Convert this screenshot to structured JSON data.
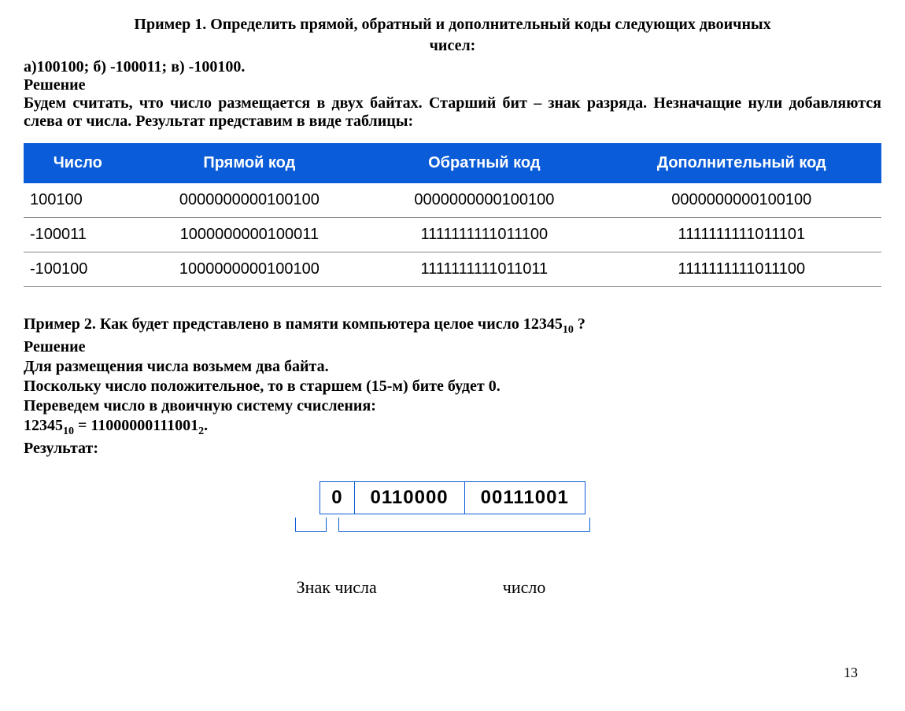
{
  "example1": {
    "title_l1": "Пример 1. Определить прямой, обратный и дополнительный коды следующих двоичных",
    "title_l2": "чисел:",
    "given": "а)100100; б) -100011; в) -100100.",
    "solution_label": "Решение",
    "explain": "Будем считать, что число размещается в двух байтах. Старший бит – знак разряда. Незначащие нули добавляются слева от числа. Результат представим в виде таблицы:",
    "headers": {
      "num": "Число",
      "direct": "Прямой код",
      "inverse": "Обратный код",
      "complement": "Дополнительный код"
    },
    "rows": [
      {
        "num": "100100",
        "direct": "0000000000100100",
        "inverse": "0000000000100100",
        "complement": "0000000000100100"
      },
      {
        "num": "-100011",
        "direct": "1000000000100011",
        "inverse": "1111111111011100",
        "complement": "1111111111011101"
      },
      {
        "num": "-100100",
        "direct": "1000000000100100",
        "inverse": "1111111111011011",
        "complement": "1111111111011100"
      }
    ]
  },
  "example2": {
    "title_prefix": "Пример 2. Как будет представлено в памяти компьютера целое число 12345",
    "title_sub": "10",
    "title_suffix": " ?",
    "solution_label": "Решение",
    "line_bytes": "Для размещения числа возьмем два байта.",
    "line_positive": "Поскольку число положительное, то в старшем (15-м) бите будет 0.",
    "line_convert": "Переведем число в двоичную систему счисления:",
    "eq_prefix": "12345",
    "eq_sub1": "10",
    "eq_mid": " = 11000000111001",
    "eq_sub2": "2",
    "eq_suffix": ".",
    "result_label": "Результат:",
    "memory": {
      "sign": "0",
      "hi": "0110000",
      "lo": "00111001"
    },
    "labels": {
      "sign": "Знак числа",
      "number": "число"
    }
  },
  "page_number": "13"
}
